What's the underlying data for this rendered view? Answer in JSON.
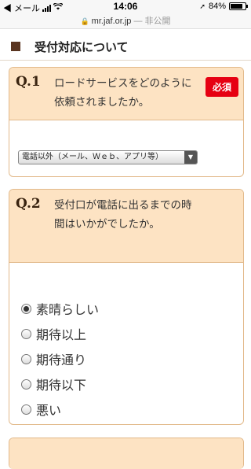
{
  "status_bar": {
    "carrier": "◀ メール",
    "time": "14:06",
    "battery": "84%",
    "battery_level": 0.84
  },
  "url_bar": {
    "domain": "mr.jaf.or.jp",
    "suffix": "— 非公開"
  },
  "section": {
    "title": "受付対応について"
  },
  "questions": [
    {
      "number": "Q.1",
      "text": "ロードサービスをどのように依頼されましたか。",
      "required_label": "必須",
      "select_value": "電話以外（メール、Ｗｅｂ、アプリ等）"
    },
    {
      "number": "Q.2",
      "text": "受付口が電話に出るまでの時間はいかがでしたか。",
      "options": [
        "素晴らしい",
        "期待以上",
        "期待通り",
        "期待以下",
        "悪い"
      ],
      "selected_index": 0
    }
  ],
  "colors": {
    "card_header_bg": "#fde3c3",
    "card_border": "#e2b98a",
    "required_badge": "#e60012",
    "section_square": "#5a3520"
  }
}
